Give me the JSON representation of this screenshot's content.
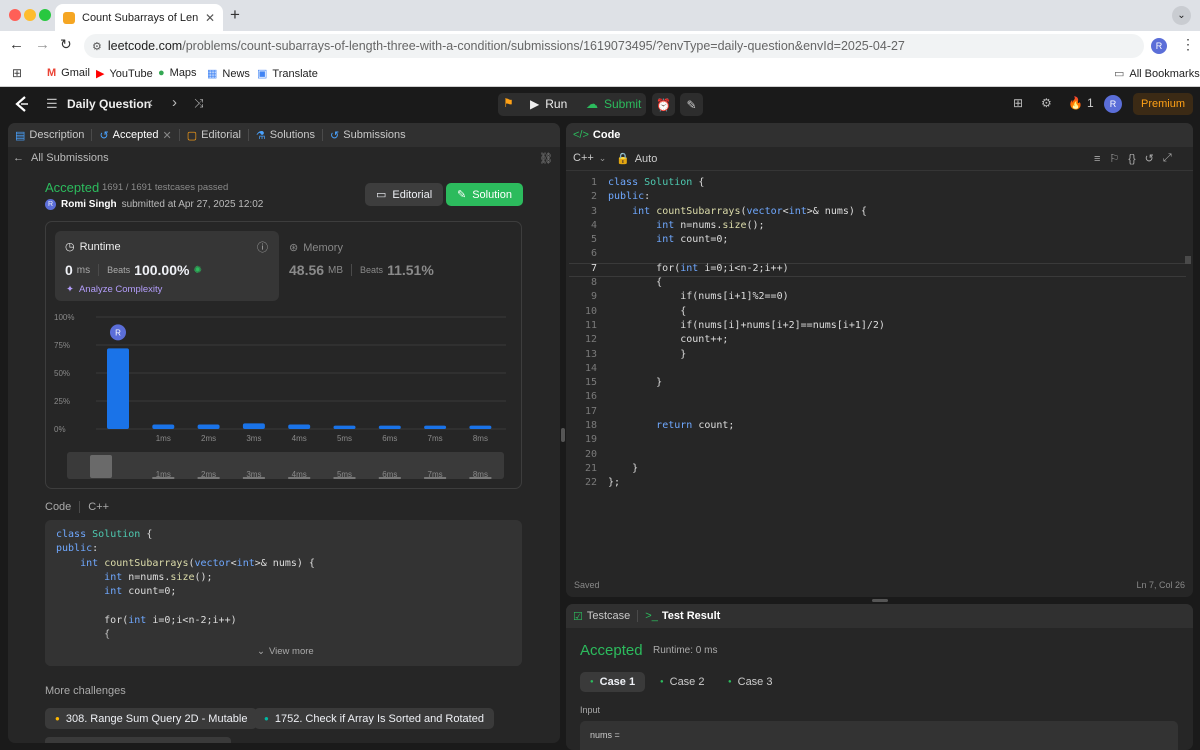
{
  "browser": {
    "tab_title": "Count Subarrays of Length Th",
    "url_host": "leetcode.com",
    "url_path": "/problems/count-subarrays-of-length-three-with-a-condition/submissions/1619073495/?envType=daily-question&envId=2025-04-27",
    "avatar_letter": "R",
    "bookmarks": [
      "Gmail",
      "YouTube",
      "Maps",
      "News",
      "Translate"
    ],
    "all_bookmarks": "All Bookmarks"
  },
  "appbar": {
    "title": "Daily Question",
    "run": "Run",
    "submit": "Submit",
    "streak": "1",
    "avatar": "R",
    "premium": "Premium"
  },
  "left": {
    "tabs": [
      "Description",
      "Accepted",
      "Editorial",
      "Solutions",
      "Submissions"
    ],
    "back": "All Submissions",
    "status": "Accepted",
    "testcases": "1691 / 1691 testcases passed",
    "user_initial": "R",
    "user": "Romi Singh",
    "submitted": "submitted at Apr 27, 2025 12:02",
    "editorial_btn": "Editorial",
    "solution_btn": "Solution",
    "runtime": {
      "title": "Runtime",
      "value": "0",
      "unit": "ms",
      "beats_label": "Beats",
      "beats": "100.00%",
      "analyze": "Analyze Complexity"
    },
    "memory": {
      "title": "Memory",
      "value": "48.56",
      "unit": "MB",
      "beats_label": "Beats",
      "beats": "11.51%"
    },
    "code_label": "Code",
    "lang": "C++",
    "view_more": "View more",
    "more_title": "More challenges",
    "challenges": [
      "308. Range Sum Query 2D - Mutable",
      "1752. Check if Array Is Sorted and Rotated"
    ]
  },
  "chart_data": {
    "type": "bar",
    "yticks": [
      "100%",
      "75%",
      "50%",
      "25%",
      "0%"
    ],
    "categories": [
      "",
      "1ms",
      "2ms",
      "3ms",
      "4ms",
      "5ms",
      "6ms",
      "7ms",
      "8ms"
    ],
    "values": [
      72,
      4,
      4,
      5,
      4,
      3,
      3,
      3,
      3
    ],
    "ylim": [
      0,
      100
    ],
    "marker": "R",
    "bar_color": "#1a73e8"
  },
  "editor": {
    "title": "Code",
    "lang": "C++",
    "mode": "Auto",
    "saved": "Saved",
    "cursor": "Ln 7, Col 26",
    "lines": [
      "class Solution {",
      "public:",
      "    int countSubarrays(vector<int>& nums) {",
      "        int n=nums.size();",
      "        int count=0;",
      "",
      "        for(int i=0;i<n-2;i++)",
      "        {",
      "            if(nums[i+1]%2==0)",
      "            {",
      "            if(nums[i]+nums[i+2]==nums[i+1]/2)",
      "            count++;",
      "            }",
      "",
      "        }",
      "",
      "",
      "        return count;",
      "",
      "",
      "    }",
      "};"
    ],
    "preview": [
      "class Solution {",
      "public:",
      "    int countSubarrays(vector<int>& nums) {",
      "        int n=nums.size();",
      "        int count=0;",
      "",
      "        for(int i=0;i<n-2;i++)",
      "        {"
    ]
  },
  "result": {
    "tab1": "Testcase",
    "tab2": "Test Result",
    "status": "Accepted",
    "runtime": "Runtime: 0 ms",
    "cases": [
      "Case 1",
      "Case 2",
      "Case 3"
    ],
    "input_label": "Input",
    "input_value": "nums ="
  }
}
